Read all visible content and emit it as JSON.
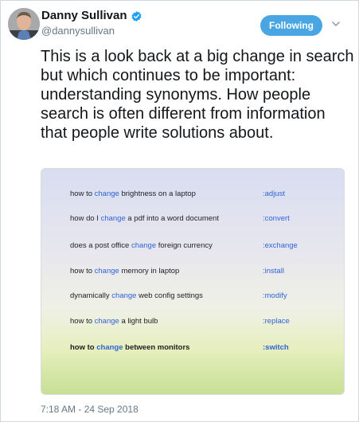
{
  "author": {
    "name": "Danny Sullivan",
    "handle": "@dannysullivan",
    "verified_icon": "verified-badge-icon"
  },
  "follow_button": {
    "label": "Following"
  },
  "more_menu": {
    "icon": "chevron-down-icon"
  },
  "tweet": {
    "text": "This is a look back at a big change in search but which continues to be important: understanding synonyms. How people search is often different from information that people write solutions about."
  },
  "media": {
    "rows": [
      {
        "before": "how to ",
        "highlight": "change",
        "after": " brightness on a laptop",
        "tag": ":adjust"
      },
      {
        "before": "how do I ",
        "highlight": "change",
        "after": " a pdf into a word document",
        "tag": ":convert"
      },
      {
        "before": "does a post office ",
        "highlight": "change",
        "after": " foreign currency",
        "tag": ":exchange"
      },
      {
        "before": "how to ",
        "highlight": "change",
        "after": " memory in laptop",
        "tag": ":install"
      },
      {
        "before": "dynamically ",
        "highlight": "change",
        "after": " web config settings",
        "tag": ":modify"
      },
      {
        "before": "how to ",
        "highlight": "change",
        "after": " a light bulb",
        "tag": ":replace"
      },
      {
        "before": "how to ",
        "highlight": "change",
        "after": " between monitors",
        "tag": ":switch"
      }
    ]
  },
  "timestamp": "7:18 AM - 24 Sep 2018",
  "colors": {
    "accent": "#4aa5e3",
    "highlight": "#2f63d8",
    "secondary_text": "#657786"
  }
}
